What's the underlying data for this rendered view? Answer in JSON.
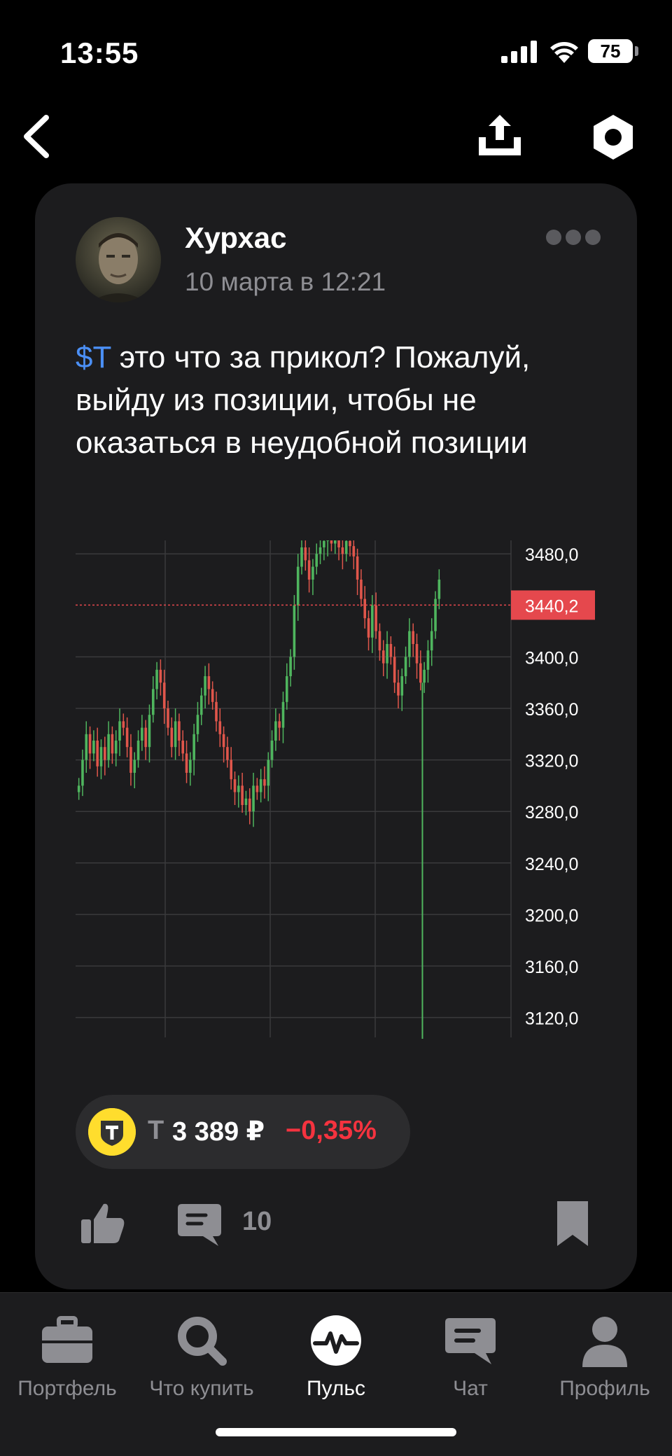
{
  "status_bar": {
    "time": "13:55",
    "battery": "75"
  },
  "post": {
    "author": "Хурхас",
    "date": "10 марта в 12:21",
    "ticker_tag": "$T",
    "text_rest": " это что за прикол? Пожалуй, выйду из позиции, чтобы не оказаться в неудобной позиции",
    "comments_count": "10"
  },
  "ticker_chip": {
    "ticker": "Т",
    "price": "3 389 ₽",
    "change": "−0,35%"
  },
  "chart_data": {
    "type": "candlestick",
    "y_ticks": [
      "3480,0",
      "3440,2",
      "3400,0",
      "3360,0",
      "3320,0",
      "3280,0",
      "3240,0",
      "3200,0",
      "3160,0",
      "3120,0"
    ],
    "y_tick_values": [
      3480,
      3440.2,
      3400,
      3360,
      3320,
      3280,
      3240,
      3200,
      3160,
      3120
    ],
    "current_price": 3440.2,
    "current_price_label": "3440,2",
    "ylim": [
      3110,
      3485
    ],
    "grid": true,
    "colors": {
      "up": "#4fb55e",
      "down": "#e0564b",
      "current_price": "#e5484d"
    },
    "closes": [
      3300,
      3320,
      3340,
      3325,
      3335,
      3315,
      3330,
      3320,
      3340,
      3325,
      3335,
      3350,
      3345,
      3330,
      3310,
      3320,
      3335,
      3345,
      3330,
      3355,
      3375,
      3390,
      3380,
      3360,
      3345,
      3330,
      3350,
      3335,
      3325,
      3310,
      3320,
      3340,
      3355,
      3370,
      3385,
      3375,
      3365,
      3350,
      3340,
      3330,
      3320,
      3305,
      3295,
      3300,
      3285,
      3290,
      3280,
      3300,
      3295,
      3305,
      3300,
      3320,
      3335,
      3350,
      3345,
      3365,
      3385,
      3400,
      3440,
      3470,
      3485,
      3475,
      3460,
      3470,
      3480,
      3485,
      3490,
      3495,
      3488,
      3492,
      3485,
      3480,
      3490,
      3486,
      3478,
      3460,
      3445,
      3430,
      3415,
      3440,
      3420,
      3405,
      3395,
      3410,
      3400,
      3380,
      3370,
      3385,
      3400,
      3420,
      3410,
      3395,
      3380,
      3390,
      3405,
      3420,
      3445,
      3460
    ]
  },
  "tabs": [
    {
      "label": "Портфель"
    },
    {
      "label": "Что купить"
    },
    {
      "label": "Пульс"
    },
    {
      "label": "Чат"
    },
    {
      "label": "Профиль"
    }
  ],
  "colors": {
    "background": "#000000",
    "card": "#1c1c1e",
    "link": "#4b8ff5",
    "negative": "#f5333f",
    "accent_yellow": "#ffdd2d"
  }
}
